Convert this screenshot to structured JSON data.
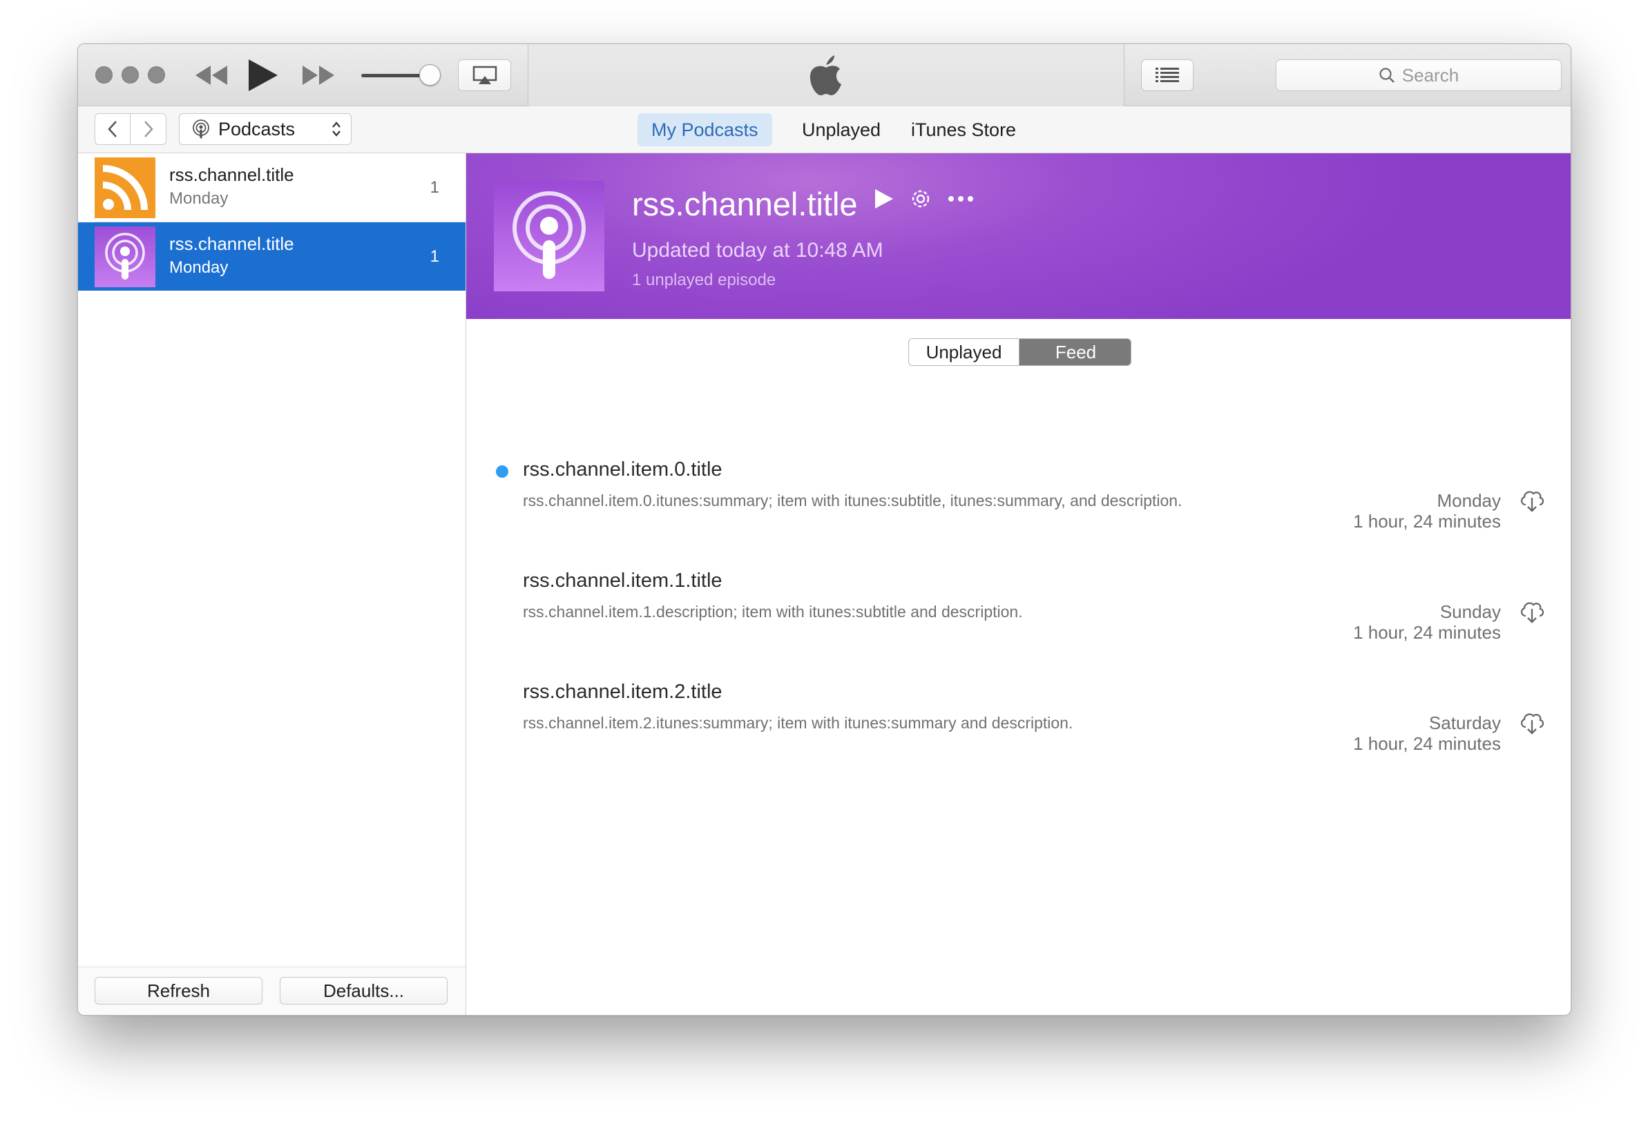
{
  "toolbar": {
    "search_placeholder": "Search"
  },
  "navbar": {
    "media_kind": "Podcasts",
    "tabs": [
      {
        "label": "My Podcasts",
        "active": true
      },
      {
        "label": "Unplayed",
        "active": false
      },
      {
        "label": "iTunes Store",
        "active": false
      }
    ]
  },
  "sidebar": {
    "podcasts": [
      {
        "title": "rss.channel.title",
        "date": "Monday",
        "count": "1",
        "art": "rss-icon",
        "selected": false
      },
      {
        "title": "rss.channel.title",
        "date": "Monday",
        "count": "1",
        "art": "podcast-icon",
        "selected": true
      }
    ],
    "refresh_label": "Refresh",
    "defaults_label": "Defaults..."
  },
  "banner": {
    "title": "rss.channel.title",
    "updated": "Updated today at 10:48 AM",
    "unplayed": "1 unplayed episode",
    "color": "#9a4ed0"
  },
  "view_toggle": {
    "options": [
      "Unplayed",
      "Feed"
    ],
    "selected": "Feed"
  },
  "episodes": [
    {
      "title": "rss.channel.item.0.title",
      "description": "rss.channel.item.0.itunes:summary; item with itunes:subtitle, itunes:summary, and description.",
      "date": "Monday",
      "duration": "1 hour, 24 minutes",
      "unplayed": true
    },
    {
      "title": "rss.channel.item.1.title",
      "description": "rss.channel.item.1.description; item with itunes:subtitle and description.",
      "date": "Sunday",
      "duration": "1 hour, 24 minutes",
      "unplayed": false
    },
    {
      "title": "rss.channel.item.2.title",
      "description": "rss.channel.item.2.itunes:summary; item with itunes:summary and description.",
      "date": "Saturday",
      "duration": "1 hour, 24 minutes",
      "unplayed": false
    }
  ],
  "colors": {
    "selection_blue": "#1b6fd1",
    "unplayed_dot": "#2f9ef0",
    "tab_active_bg": "#d7e7f7",
    "tab_active_text": "#2f6bb5"
  }
}
